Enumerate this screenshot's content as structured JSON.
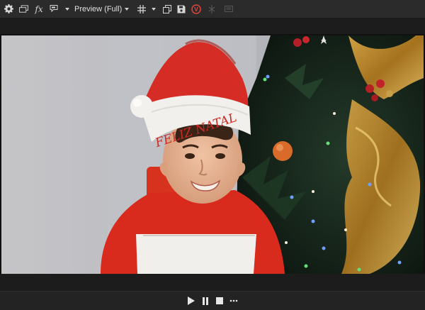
{
  "toolbar": {
    "settings_icon": "gear-icon",
    "window_icon": "window-stack-icon",
    "fx_label": "fx",
    "flag_icon": "flag-icon",
    "preview_mode": "Preview (Full)",
    "grid_icon": "grid-icon",
    "copy_icon": "copy-icon",
    "save_icon": "save-icon",
    "vfx_badge": "V",
    "vfx_color": "#e0463c",
    "split_icon": "split-icon",
    "safe_area_icon": "safe-area-icon"
  },
  "preview": {
    "image": "child-in-santa-hat-by-christmas-tree",
    "hat_text": "FELIZ NATAL"
  },
  "transport": {
    "play_icon": "play-icon",
    "pause_icon": "pause-icon",
    "stop_icon": "stop-icon",
    "more_icon": "more-icon"
  },
  "colors": {
    "toolbar_bg": "#2b2b2b",
    "panel_bg": "#1e1e1e",
    "accent_red": "#e0463c"
  }
}
